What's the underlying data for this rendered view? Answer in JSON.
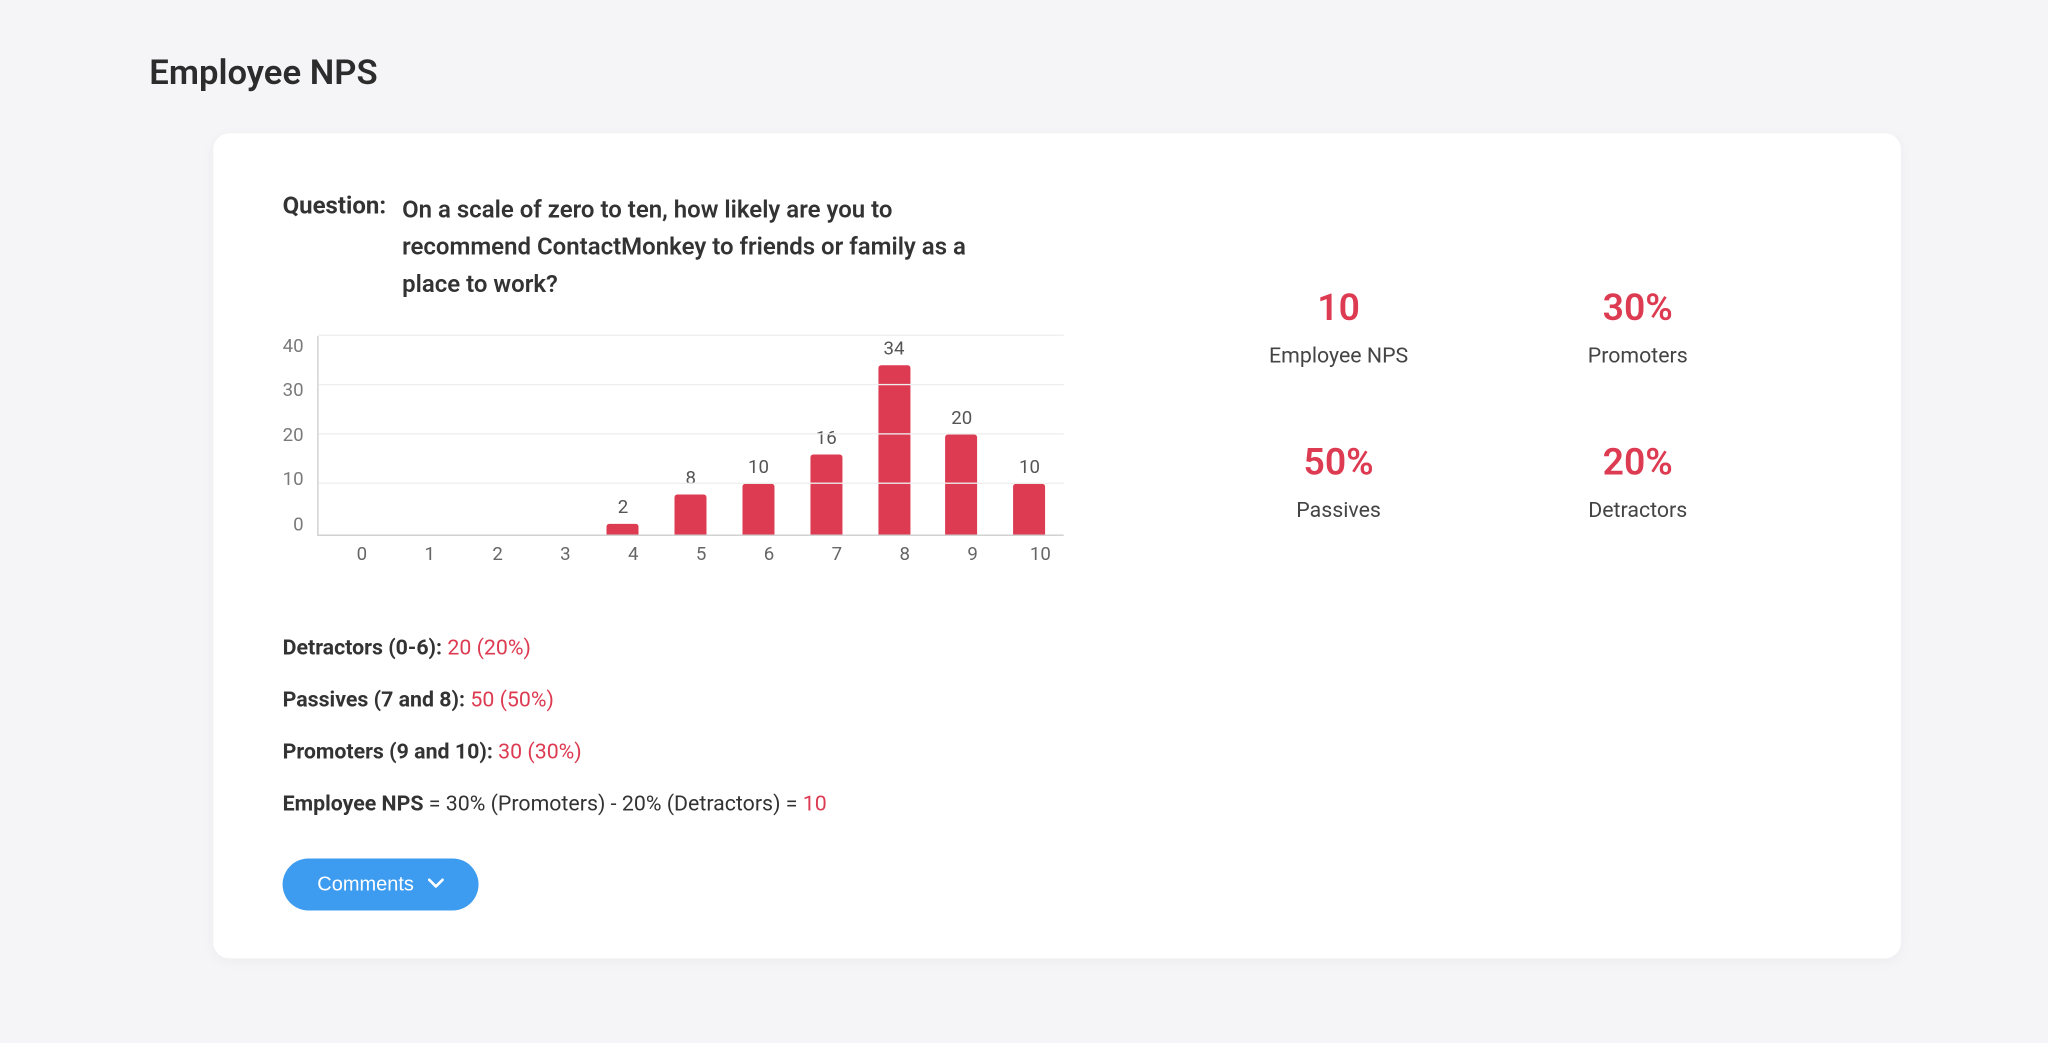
{
  "page_title": "Employee NPS",
  "question_label": "Question:",
  "question_text": "On a scale of zero to ten, how likely are you to recommend ContactMonkey to friends or family as a place to work?",
  "chart_data": {
    "type": "bar",
    "categories": [
      "0",
      "1",
      "2",
      "3",
      "4",
      "5",
      "6",
      "7",
      "8",
      "9",
      "10"
    ],
    "values": [
      0,
      0,
      0,
      0,
      2,
      8,
      10,
      16,
      34,
      20,
      10
    ],
    "title": "",
    "xlabel": "",
    "ylabel": "",
    "ylim": [
      0,
      40
    ],
    "yticks": [
      0,
      10,
      20,
      30,
      40
    ],
    "bar_color": "#dd3b52"
  },
  "stats": {
    "nps": {
      "value": "10",
      "label": "Employee NPS"
    },
    "promoters": {
      "value": "30%",
      "label": "Promoters"
    },
    "passives": {
      "value": "50%",
      "label": "Passives"
    },
    "detractors": {
      "value": "20%",
      "label": "Detractors"
    }
  },
  "breakdown": {
    "detractors_label": "Detractors (0-6): ",
    "detractors_value": "20 (20%)",
    "passives_label": "Passives (7 and 8): ",
    "passives_value": "50 (50%)",
    "promoters_label": "Promoters (9 and 10): ",
    "promoters_value": "30 (30%)",
    "formula_label": "Employee NPS",
    "formula_text": " = 30% (Promoters) - 20% (Detractors) = ",
    "formula_result": "10"
  },
  "comments_button": "Comments"
}
